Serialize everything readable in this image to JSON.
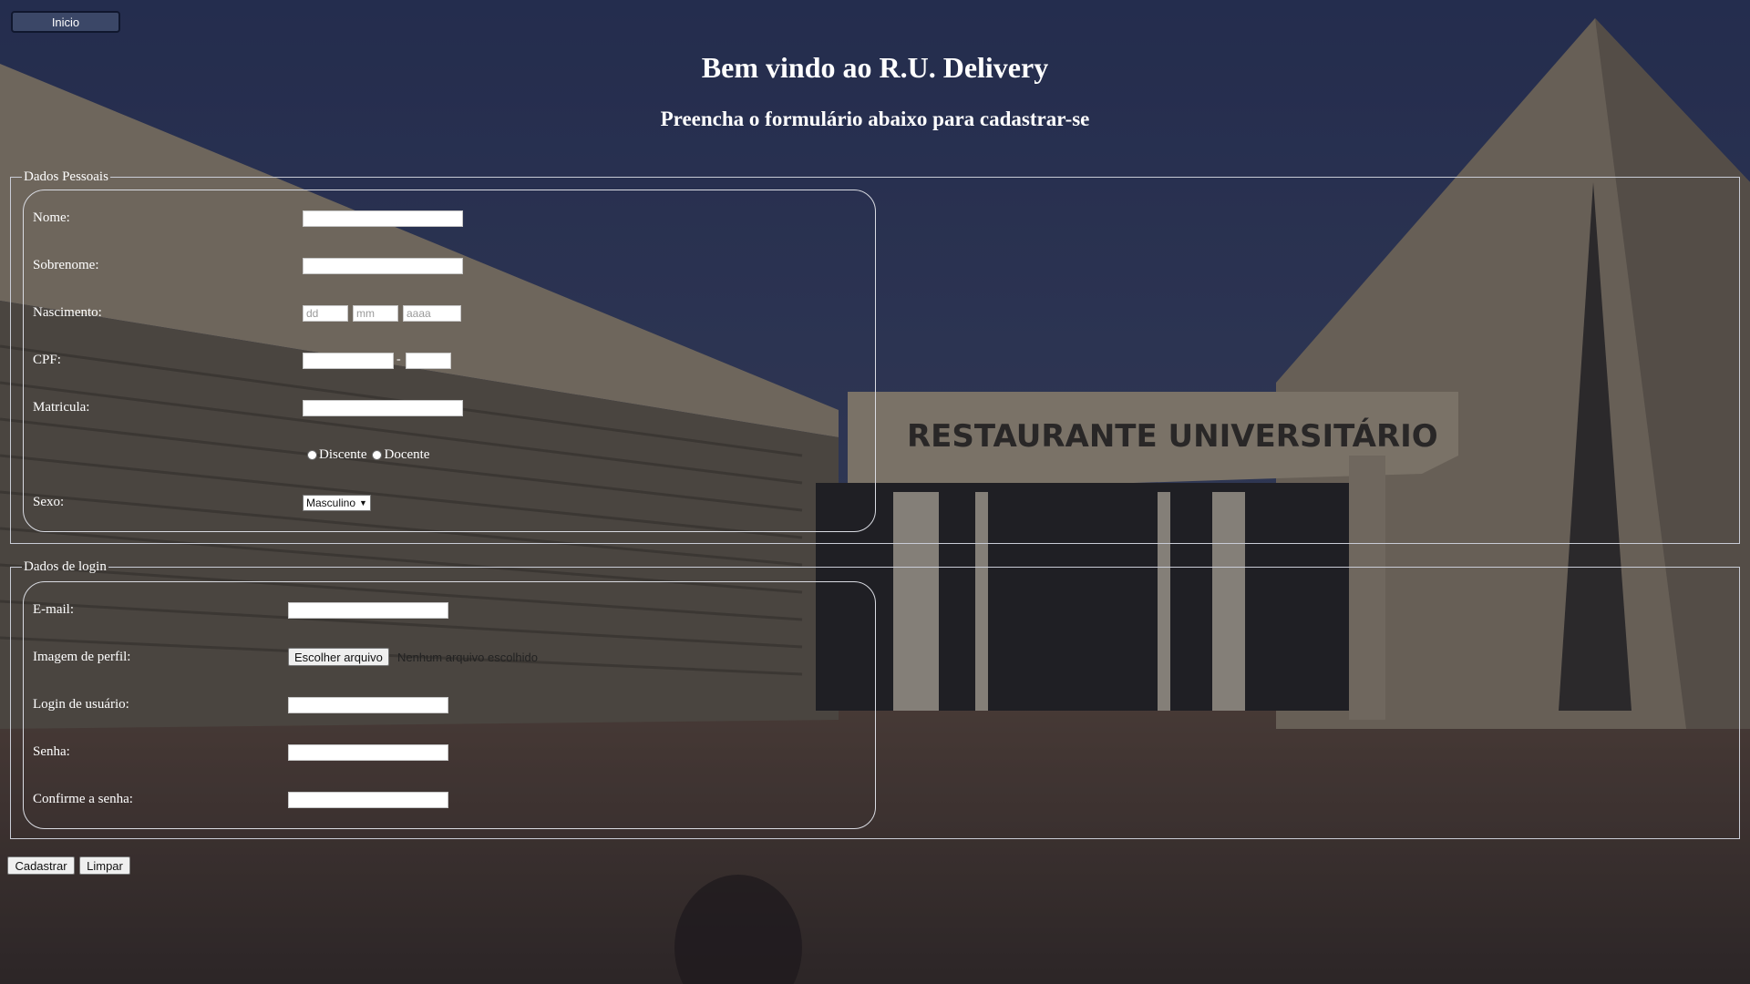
{
  "nav": {
    "home_label": "Inicio"
  },
  "header": {
    "title": "Bem vindo ao R.U. Delivery",
    "subtitle": "Preencha o formulário abaixo para cadastrar-se"
  },
  "background": {
    "building_sign": "RESTAURANTE UNIVERSITÁRIO"
  },
  "personal": {
    "legend": "Dados Pessoais",
    "nome_label": "Nome:",
    "sobrenome_label": "Sobrenome:",
    "nascimento_label": "Nascimento:",
    "dd_placeholder": "dd",
    "mm_placeholder": "mm",
    "aaaa_placeholder": "aaaa",
    "cpf_label": "CPF:",
    "cpf_separator": "-",
    "matricula_label": "Matricula:",
    "radio_discente": "Discente",
    "radio_docente": "Docente",
    "sexo_label": "Sexo:",
    "sexo_selected": "Masculino"
  },
  "login": {
    "legend": "Dados de login",
    "email_label": "E-mail:",
    "imagem_label": "Imagem de perfil:",
    "file_button": "Escolher arquivo",
    "file_status": "Nenhum arquivo escolhido",
    "usuario_label": "Login de usuário:",
    "senha_label": "Senha:",
    "confirme_label": "Confirme a senha:"
  },
  "actions": {
    "submit": "Cadastrar",
    "reset": "Limpar"
  },
  "colors": {
    "sky": "#2e3a63",
    "building": "#8a8170",
    "ground": "#5b4b40"
  }
}
